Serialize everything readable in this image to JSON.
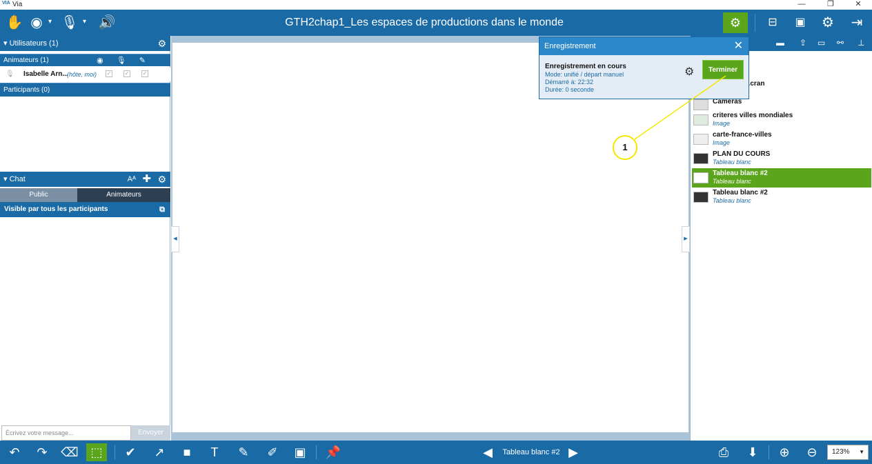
{
  "window": {
    "logo": "VIA",
    "title": "Via",
    "controls": [
      "—",
      "❐",
      "✕"
    ]
  },
  "toolbar": {
    "doc_title": "GTH2chap1_Les espaces de productions dans le monde"
  },
  "users": {
    "header": "Utilisateurs (1)",
    "animators_label": "Animateurs (1)",
    "user_name": "Isabelle Arn...",
    "user_role": "(hôte, moi)",
    "participants_label": "Participants (0)"
  },
  "chat": {
    "header": "Chat",
    "tab_public": "Public",
    "tab_animators": "Animateurs",
    "visible_label": "Visible par tous les participants",
    "input_placeholder": "Écrivez votre message...",
    "send_label": "Envoyer"
  },
  "recording": {
    "title": "Enregistrement",
    "status": "Enregistrement en cours",
    "mode": "Mode: unifié / départ manuel",
    "started": "Démarré à: 22:32",
    "duration": "Durée: 0 seconde",
    "button": "Terminer"
  },
  "documents": [
    {
      "name": "...cran",
      "type": ""
    },
    {
      "name": "Caméras",
      "type": ""
    },
    {
      "name": "criteres villes mondiales",
      "type": "Image"
    },
    {
      "name": "carte-france-villes",
      "type": "Image"
    },
    {
      "name": "PLAN DU COURS",
      "type": "Tableau blanc"
    },
    {
      "name": "Tableau blanc #2",
      "type": "Tableau blanc"
    },
    {
      "name": "Tableau blanc #2",
      "type": "Tableau blanc"
    }
  ],
  "annotation": "1",
  "bottombar": {
    "page_label": "Tableau blanc #2",
    "zoom": "123%"
  },
  "colors": {
    "primary": "#1a6aa6",
    "accent": "#5aa51c",
    "annotation": "#f5e800"
  }
}
